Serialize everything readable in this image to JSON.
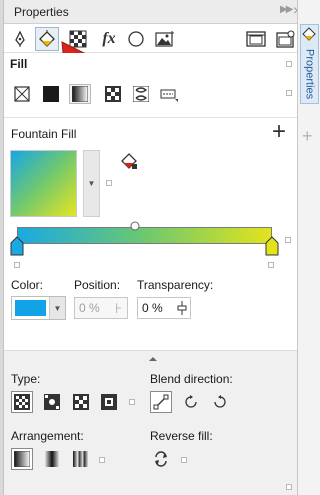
{
  "panel": {
    "title": "Properties"
  },
  "docker": {
    "tab_label": "Properties"
  },
  "fill": {
    "section_label": "Fill",
    "fountain_label": "Fountain Fill",
    "add_symbol": "+"
  },
  "color_row": {
    "color_label": "Color:",
    "position_label": "Position:",
    "position_value": "0 %",
    "transparency_label": "Transparency:",
    "transparency_value": "0 %",
    "color_hex": "#12a3e6"
  },
  "type_section": {
    "type_label": "Type:",
    "blend_label": "Blend direction:",
    "arrangement_label": "Arrangement:",
    "reverse_label": "Reverse fill:"
  },
  "colors": {
    "gradient_start": "#1aa9e2",
    "gradient_end": "#e3e31c",
    "annotation_arrow": "#d8241c"
  }
}
